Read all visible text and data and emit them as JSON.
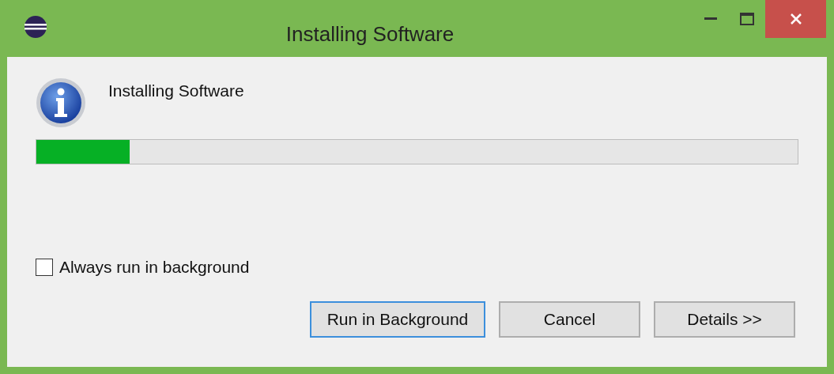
{
  "window": {
    "title": "Installing Software"
  },
  "message": "Installing Software",
  "progress": {
    "level": 0.123
  },
  "checkbox": {
    "label": "Always run in background",
    "checked": false
  },
  "buttons": [
    {
      "label": "Run in Background",
      "focused": true
    },
    {
      "label": "Cancel",
      "focused": false
    },
    {
      "label": "Details >>",
      "focused": false
    }
  ]
}
